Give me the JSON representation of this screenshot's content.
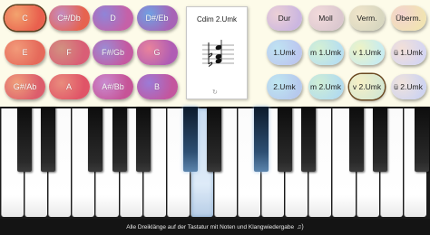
{
  "notes": [
    {
      "label": "C",
      "c1": "#e9604e",
      "c2": "#f3a36e",
      "selected": true
    },
    {
      "label": "C#/Db",
      "c1": "#e6634f",
      "c2": "#c58cc0"
    },
    {
      "label": "D",
      "c1": "#c561a8",
      "c2": "#8f85d8"
    },
    {
      "label": "D#/Eb",
      "c1": "#a763b6",
      "c2": "#6fa1e4"
    },
    {
      "label": "E",
      "c1": "#e56a5b",
      "c2": "#f29a79"
    },
    {
      "label": "F",
      "c1": "#d95e76",
      "c2": "#d29180"
    },
    {
      "label": "F#/Gb",
      "c1": "#c45aa1",
      "c2": "#9c8bd4"
    },
    {
      "label": "G",
      "c1": "#b05db4",
      "c2": "#e9839c"
    },
    {
      "label": "G#/Ab",
      "c1": "#dc5d6c",
      "c2": "#f0a07b"
    },
    {
      "label": "A",
      "c1": "#e05467",
      "c2": "#e98c7d"
    },
    {
      "label": "A#/Bb",
      "c1": "#c65497",
      "c2": "#c98bd0"
    },
    {
      "label": "B",
      "c1": "#c3569e",
      "c2": "#9c7bd7"
    }
  ],
  "chords": [
    {
      "label": "Dur",
      "c1": "#ecd0d6",
      "c2": "#cbb6e0"
    },
    {
      "label": "Moll",
      "c1": "#f2dadb",
      "c2": "#dbc8cf"
    },
    {
      "label": "Verm.",
      "c1": "#f0e5ca",
      "c2": "#d8d7c0"
    },
    {
      "label": "Überm.",
      "c1": "#f3d3cf",
      "c2": "#f1e3b2"
    },
    {
      "label": "1.Umk",
      "c1": "#bfe3f2",
      "c2": "#bcc7ef"
    },
    {
      "label": "m 1.Umk",
      "c1": "#d4f0d3",
      "c2": "#b7dff0"
    },
    {
      "label": "v 1.Umk",
      "c1": "#eef3c5",
      "c2": "#c8ecef"
    },
    {
      "label": "ü 1.Umk",
      "c1": "#f3e0d8",
      "c2": "#d6d6f1"
    },
    {
      "label": "2.Umk",
      "c1": "#bfe7f0",
      "c2": "#b6c9ee"
    },
    {
      "label": "m 2.Umk",
      "c1": "#cfeed5",
      "c2": "#b3dcee"
    },
    {
      "label": "v 2.Umk",
      "c1": "#f6efc5",
      "c2": "#d6e8d2",
      "selected": true
    },
    {
      "label": "ü 2.Umk",
      "c1": "#f0e3dc",
      "c2": "#cfd4f0"
    }
  ],
  "score": {
    "title": "Cdim 2.Umk",
    "play_icon": "↻"
  },
  "keyboard": {
    "white_highlight": [
      8
    ],
    "black_highlight": [
      5,
      7
    ]
  },
  "footer": {
    "text": "Alle Dreiklänge auf der Tastatur mit Noten und Klangwiedergabe",
    "sound_icon": "♫)"
  }
}
